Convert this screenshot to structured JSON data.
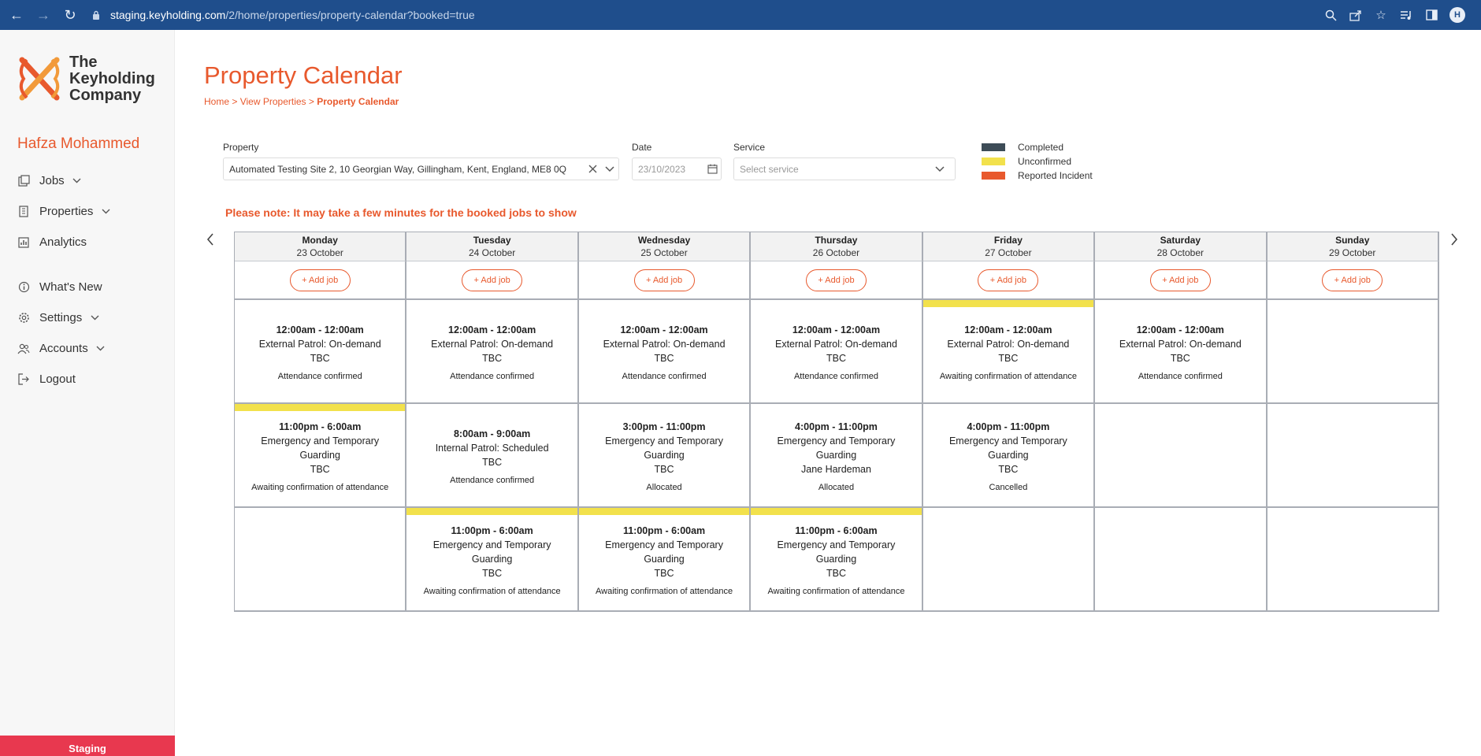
{
  "browser": {
    "url_host": "staging.keyholding.com",
    "url_path": "/2/home/properties/property-calendar?booked=true",
    "avatar_letter": "H"
  },
  "sidebar": {
    "logo_lines": [
      "The",
      "Keyholding",
      "Company"
    ],
    "user_name": "Hafza Mohammed",
    "items": [
      {
        "label": "Jobs",
        "icon": "jobs-icon",
        "has_dropdown": true
      },
      {
        "label": "Properties",
        "icon": "building-icon",
        "has_dropdown": true
      },
      {
        "label": "Analytics",
        "icon": "chart-icon",
        "has_dropdown": false
      },
      {
        "label": "What's New",
        "icon": "info-icon",
        "has_dropdown": false
      },
      {
        "label": "Settings",
        "icon": "gear-icon",
        "has_dropdown": true
      },
      {
        "label": "Accounts",
        "icon": "users-icon",
        "has_dropdown": true
      },
      {
        "label": "Logout",
        "icon": "logout-icon",
        "has_dropdown": false
      }
    ],
    "environment_badge": "Staging"
  },
  "page": {
    "title": "Property Calendar",
    "breadcrumb": {
      "home": "Home",
      "sep": ">",
      "view_properties": "View Properties",
      "current": "Property Calendar"
    }
  },
  "filters": {
    "property_label": "Property",
    "property_value": "Automated Testing Site 2, 10 Georgian Way, Gillingham, Kent, England, ME8 0Q",
    "date_label": "Date",
    "date_value": "23/10/2023",
    "service_label": "Service",
    "service_placeholder": "Select service"
  },
  "legend": [
    {
      "label": "Completed",
      "color": "#3d4c57"
    },
    {
      "label": "Unconfirmed",
      "color": "#f2e14c"
    },
    {
      "label": "Reported Incident",
      "color": "#e8592d"
    }
  ],
  "note": "Please note: It may take a few minutes for the booked jobs to show",
  "calendar": {
    "add_job_label": "+ Add job",
    "days": [
      {
        "day": "Monday",
        "date": "23 October"
      },
      {
        "day": "Tuesday",
        "date": "24 October"
      },
      {
        "day": "Wednesday",
        "date": "25 October"
      },
      {
        "day": "Thursday",
        "date": "26 October"
      },
      {
        "day": "Friday",
        "date": "27 October"
      },
      {
        "day": "Saturday",
        "date": "28 October"
      },
      {
        "day": "Sunday",
        "date": "29 October"
      }
    ],
    "rows": [
      [
        {
          "time": "12:00am - 12:00am",
          "lines": [
            "External Patrol: On-demand",
            "TBC"
          ],
          "status": "Attendance confirmed",
          "unconfirmed": false
        },
        {
          "time": "12:00am - 12:00am",
          "lines": [
            "External Patrol: On-demand",
            "TBC"
          ],
          "status": "Attendance confirmed",
          "unconfirmed": false
        },
        {
          "time": "12:00am - 12:00am",
          "lines": [
            "External Patrol: On-demand",
            "TBC"
          ],
          "status": "Attendance confirmed",
          "unconfirmed": false
        },
        {
          "time": "12:00am - 12:00am",
          "lines": [
            "External Patrol: On-demand",
            "TBC"
          ],
          "status": "Attendance confirmed",
          "unconfirmed": false
        },
        {
          "time": "12:00am - 12:00am",
          "lines": [
            "External Patrol: On-demand",
            "TBC"
          ],
          "status": "Awaiting confirmation of attendance",
          "unconfirmed": true
        },
        {
          "time": "12:00am - 12:00am",
          "lines": [
            "External Patrol: On-demand",
            "TBC"
          ],
          "status": "Attendance confirmed",
          "unconfirmed": false
        },
        null
      ],
      [
        {
          "time": "11:00pm - 6:00am",
          "lines": [
            "Emergency and Temporary",
            "Guarding",
            "TBC"
          ],
          "status": "Awaiting confirmation of attendance",
          "unconfirmed": true
        },
        {
          "time": "8:00am - 9:00am",
          "lines": [
            "Internal Patrol: Scheduled",
            "TBC"
          ],
          "status": "Attendance confirmed",
          "unconfirmed": false
        },
        {
          "time": "3:00pm - 11:00pm",
          "lines": [
            "Emergency and Temporary",
            "Guarding",
            "TBC"
          ],
          "status": "Allocated",
          "unconfirmed": false
        },
        {
          "time": "4:00pm - 11:00pm",
          "lines": [
            "Emergency and Temporary",
            "Guarding",
            "Jane Hardeman"
          ],
          "status": "Allocated",
          "unconfirmed": false
        },
        {
          "time": "4:00pm - 11:00pm",
          "lines": [
            "Emergency and Temporary",
            "Guarding",
            "TBC"
          ],
          "status": "Cancelled",
          "unconfirmed": false
        },
        null,
        null
      ],
      [
        null,
        {
          "time": "11:00pm - 6:00am",
          "lines": [
            "Emergency and Temporary",
            "Guarding",
            "TBC"
          ],
          "status": "Awaiting confirmation of attendance",
          "unconfirmed": true
        },
        {
          "time": "11:00pm - 6:00am",
          "lines": [
            "Emergency and Temporary",
            "Guarding",
            "TBC"
          ],
          "status": "Awaiting confirmation of attendance",
          "unconfirmed": true
        },
        {
          "time": "11:00pm - 6:00am",
          "lines": [
            "Emergency and Temporary",
            "Guarding",
            "TBC"
          ],
          "status": "Awaiting confirmation of attendance",
          "unconfirmed": true
        },
        null,
        null,
        null
      ]
    ]
  }
}
